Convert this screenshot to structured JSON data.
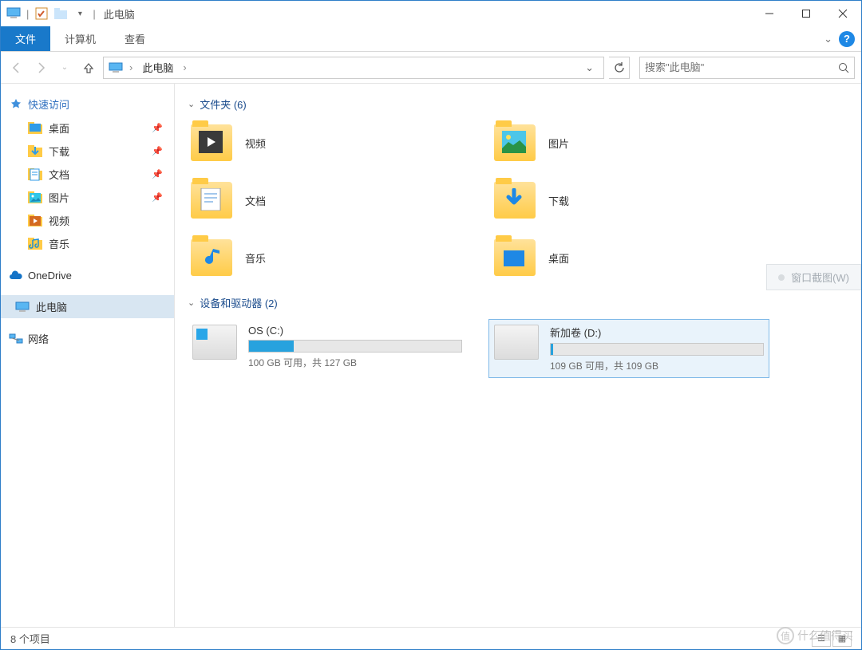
{
  "window": {
    "title": "此电脑"
  },
  "ribbon": {
    "file": "文件",
    "tabs": [
      "计算机",
      "查看"
    ]
  },
  "address": {
    "crumb": "此电脑"
  },
  "search": {
    "placeholder": "搜索\"此电脑\""
  },
  "sidebar": {
    "quick_access": {
      "label": "快速访问",
      "items": [
        {
          "label": "桌面",
          "pinned": true
        },
        {
          "label": "下载",
          "pinned": true
        },
        {
          "label": "文档",
          "pinned": true
        },
        {
          "label": "图片",
          "pinned": true
        },
        {
          "label": "视频",
          "pinned": false
        },
        {
          "label": "音乐",
          "pinned": false
        }
      ]
    },
    "onedrive": {
      "label": "OneDrive"
    },
    "this_pc": {
      "label": "此电脑"
    },
    "network": {
      "label": "网络"
    }
  },
  "sections": {
    "folders": {
      "title": "文件夹 (6)",
      "items": [
        {
          "label": "视频"
        },
        {
          "label": "图片"
        },
        {
          "label": "文档"
        },
        {
          "label": "下载"
        },
        {
          "label": "音乐"
        },
        {
          "label": "桌面"
        }
      ]
    },
    "drives": {
      "title": "设备和驱动器 (2)",
      "items": [
        {
          "name": "OS (C:)",
          "text": "100 GB 可用，共 127 GB",
          "fill_pct": 21,
          "os": true,
          "selected": false
        },
        {
          "name": "新加卷 (D:)",
          "text": "109 GB 可用，共 109 GB",
          "fill_pct": 1,
          "os": false,
          "selected": true
        }
      ]
    }
  },
  "status": {
    "text": "8 个项目"
  },
  "snip": {
    "label": "窗口截图(W)"
  },
  "watermark": {
    "text": "什么值得买"
  }
}
